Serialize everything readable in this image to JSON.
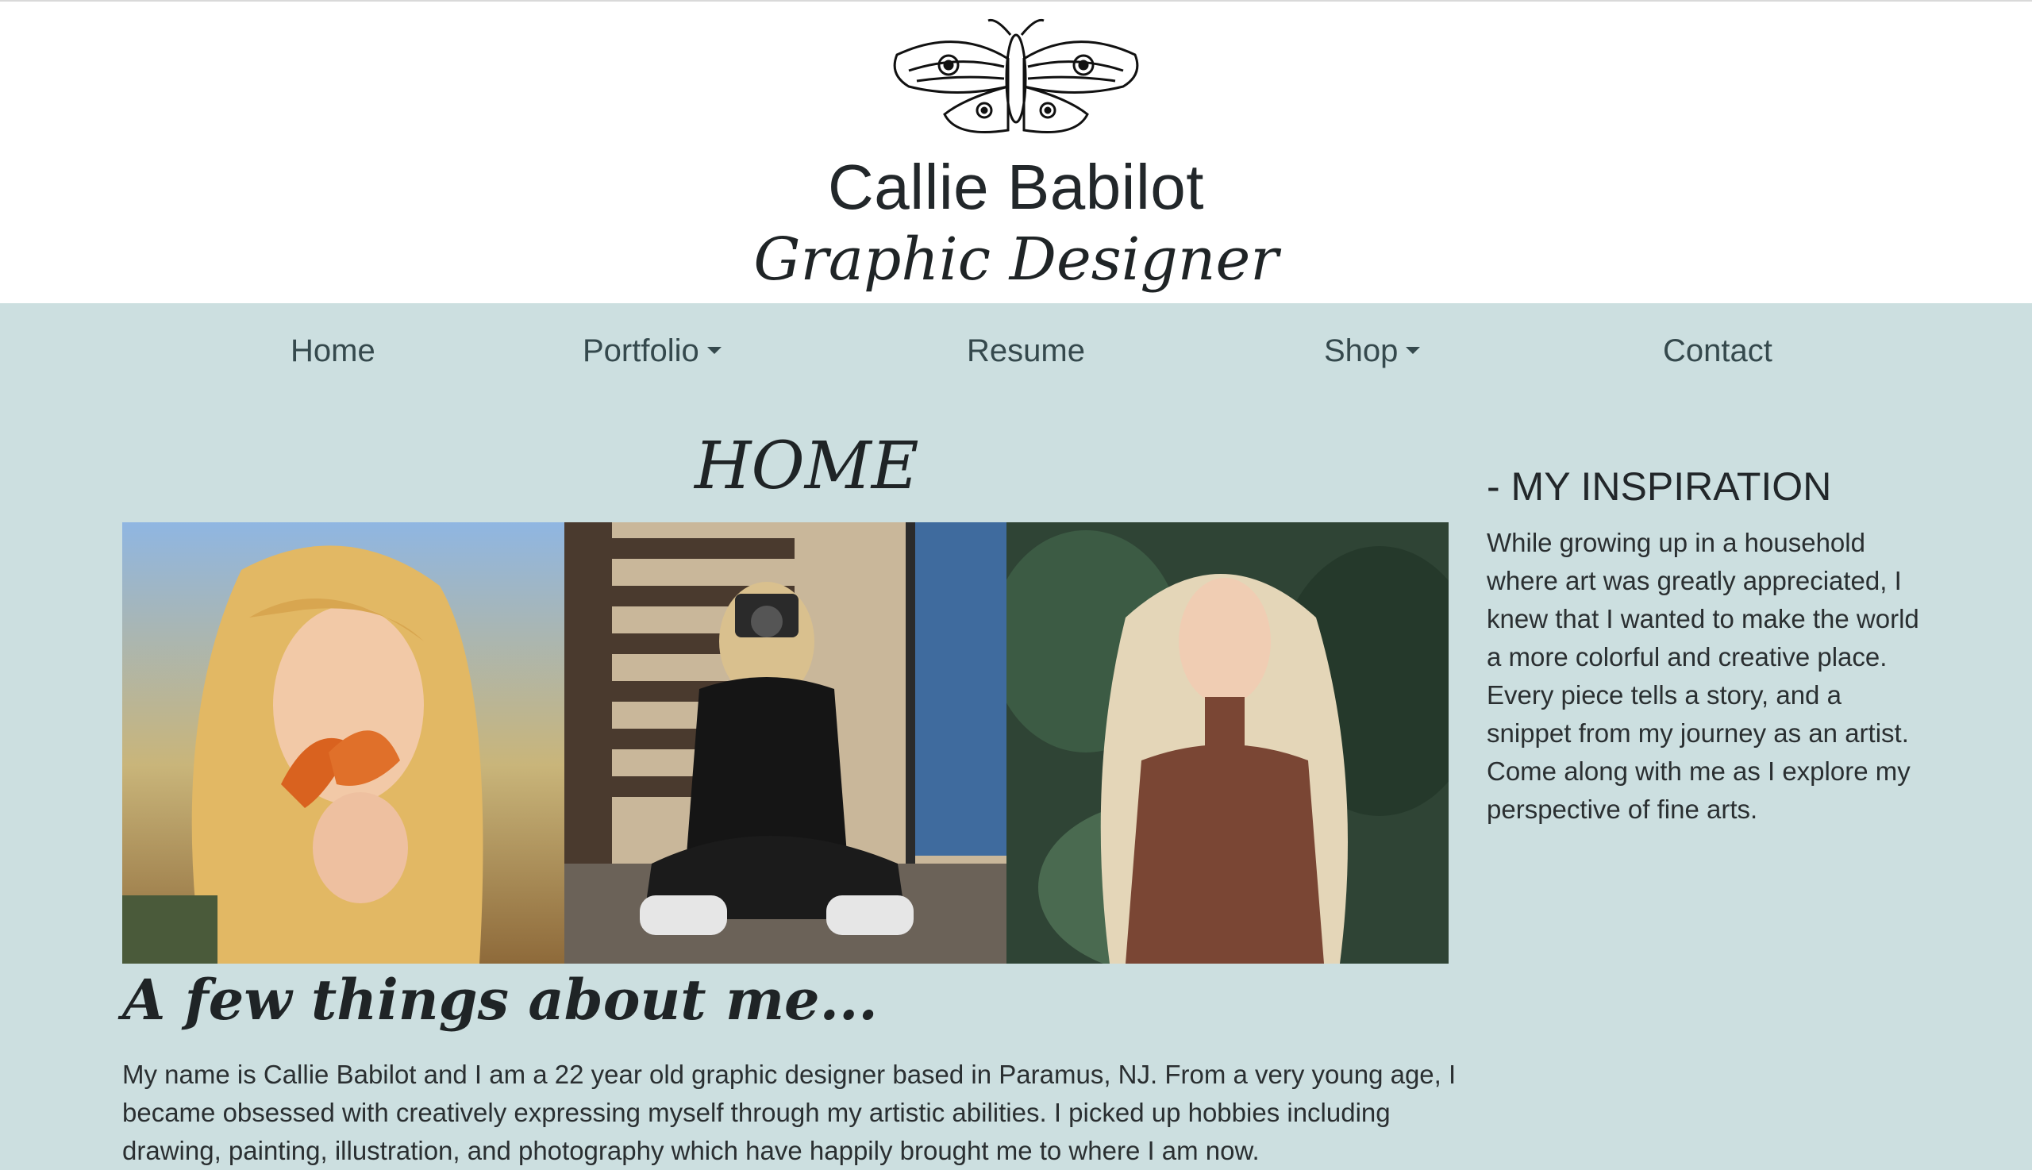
{
  "header": {
    "logo_icon": "moth-logo-icon",
    "name": "Callie Babilot",
    "role": "Graphic Designer"
  },
  "nav": {
    "items": [
      {
        "label": "Home",
        "dropdown": false
      },
      {
        "label": "Portfolio",
        "dropdown": true
      },
      {
        "label": "Resume",
        "dropdown": false
      },
      {
        "label": "Shop",
        "dropdown": true
      },
      {
        "label": "Contact",
        "dropdown": false
      }
    ]
  },
  "main": {
    "page_title": "HOME",
    "gallery": [
      {
        "icon": "photo-butterflies-portrait"
      },
      {
        "icon": "photo-camera-sitting"
      },
      {
        "icon": "photo-forest-portrait"
      }
    ],
    "about_heading": "A few things about me...",
    "about_text": "My name is Callie Babilot and I am a 22 year old graphic designer based in Paramus, NJ. From a very young age, I became obsessed with creatively expressing myself through my artistic abilities. I picked up hobbies including drawing, painting, illustration, and photography which have happily brought me to where I am now."
  },
  "sidebar": {
    "heading": "- MY INSPIRATION",
    "text": "While growing up in a household where art was greatly appreciated, I knew that I wanted to make the world a more colorful and creative place. Every piece tells a story, and a snippet from my journey as an artist. Come along with me as I explore my perspective of fine arts."
  },
  "colors": {
    "background": "#ccdfe0",
    "header_bg": "#ffffff",
    "nav_text": "#35494d"
  }
}
